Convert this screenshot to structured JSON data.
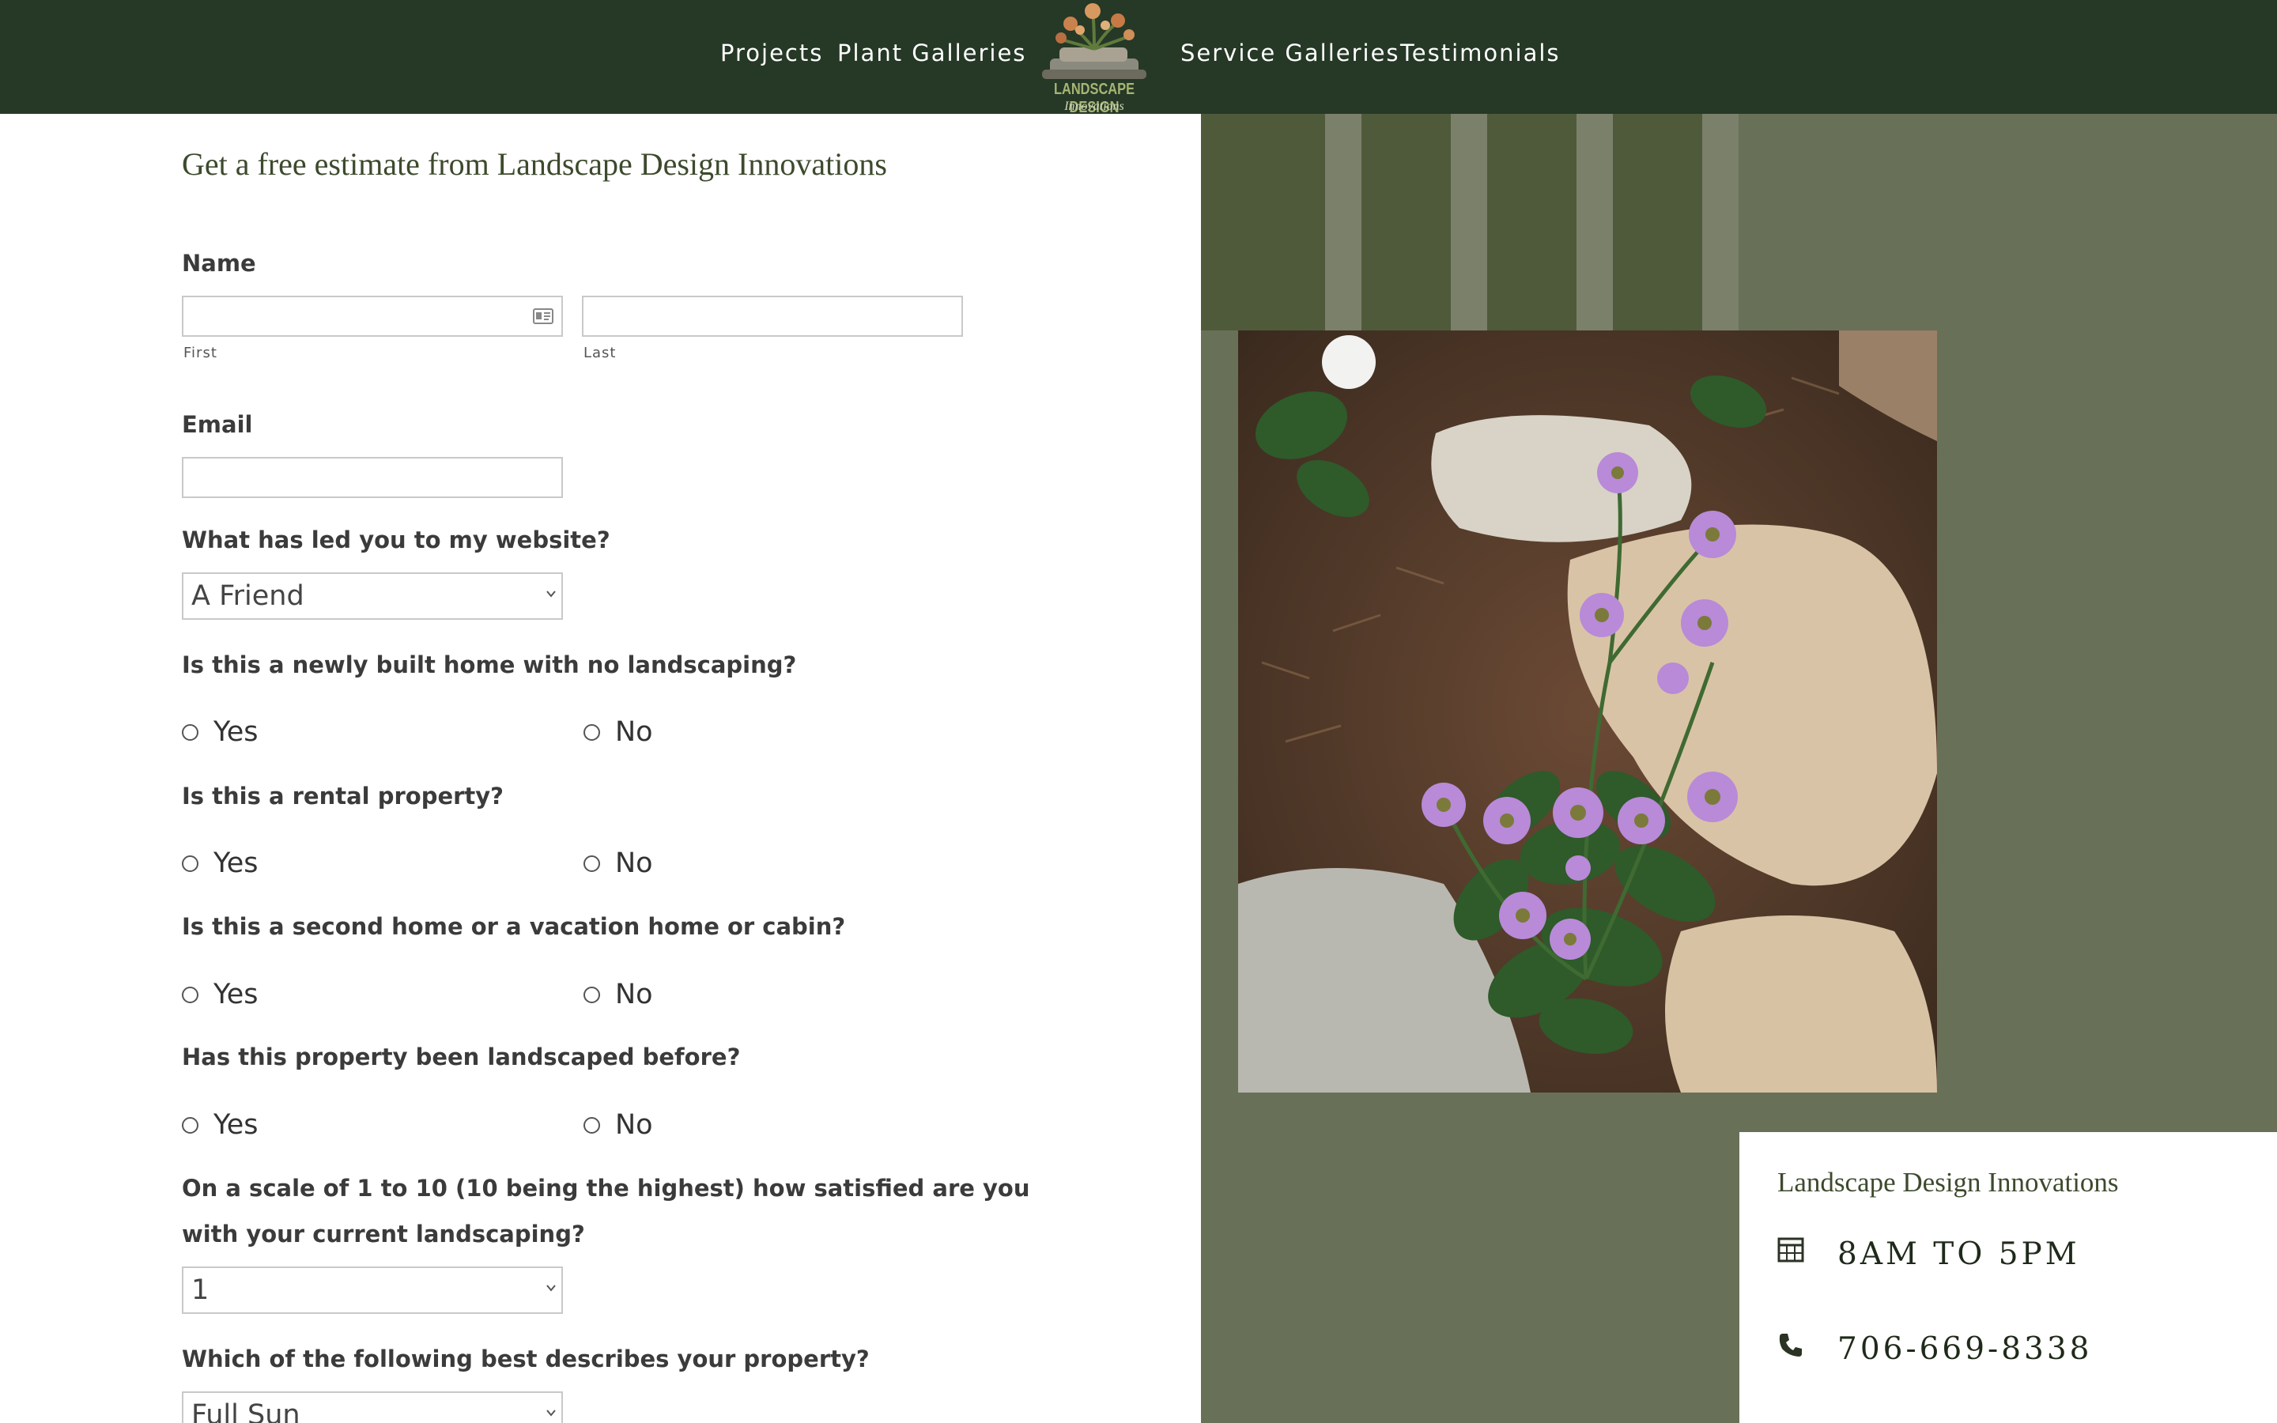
{
  "nav": {
    "items": [
      "Projects",
      "Plant Galleries",
      "Service Galleries",
      "Testimonials"
    ],
    "logo_text": "LANDSCAPE DESIGN",
    "logo_subtext": "Innovations"
  },
  "form": {
    "title": "Get a free estimate from Landscape Design Innovations",
    "name_label": "Name",
    "first_label": "First",
    "last_label": "Last",
    "email_label": "Email",
    "source_question": "What has led you to my website?",
    "source_value": "A Friend",
    "q_new_home": "Is this a newly built home with no landscaping?",
    "q_rental": "Is this a rental property?",
    "q_second_home": "Is this a second home or a vacation home or cabin?",
    "q_landscaped": "Has this property been landscaped before?",
    "yes": "Yes",
    "no": "No",
    "scale_question_line1": "On a scale of 1 to 10 (10 being the highest) how satisfied are you",
    "scale_question_line2": "with your current landscaping?",
    "scale_value": "1",
    "property_question": "Which of the following best describes your property?",
    "property_value": "Full Sun"
  },
  "info": {
    "business_name": "Landscape Design Innovations",
    "hours": "8AM TO 5PM",
    "phone": "706-669-8338",
    "hours_icon": "calendar-icon",
    "phone_icon": "phone-icon"
  },
  "colors": {
    "nav_bg": "#263826",
    "panel_bg": "#687158",
    "accent_text": "#3d4a2d"
  }
}
